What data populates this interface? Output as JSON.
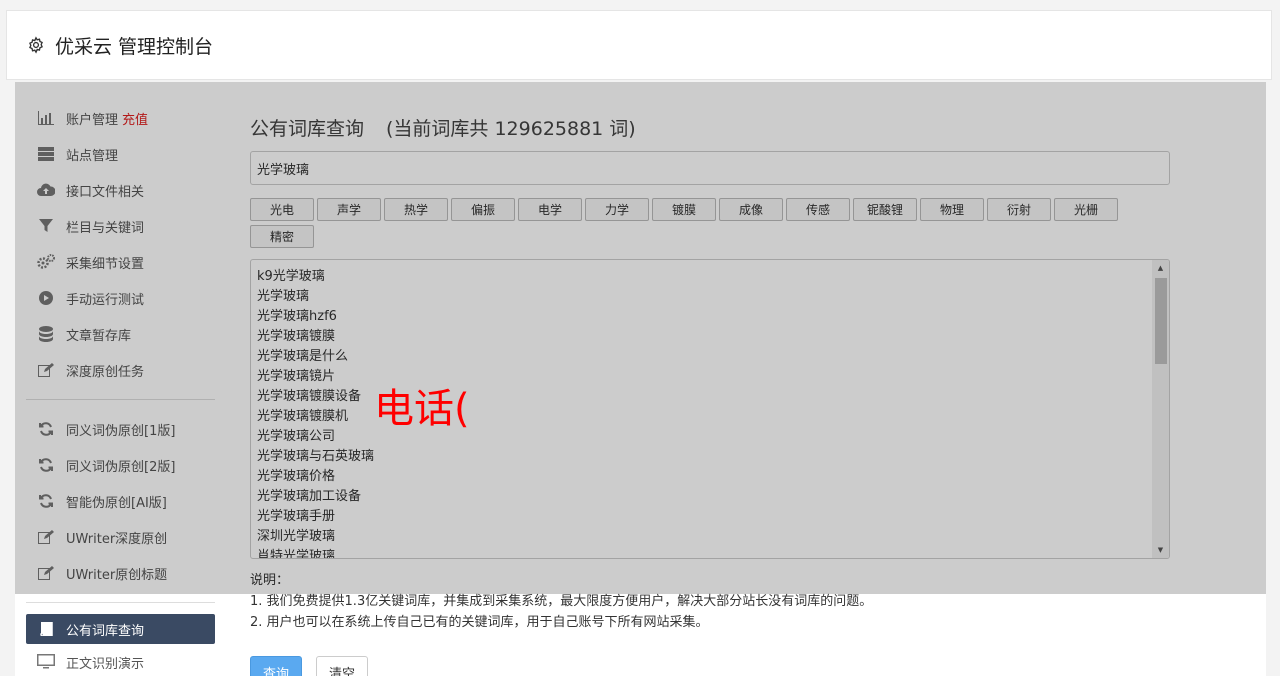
{
  "header": {
    "title": "优采云 管理控制台"
  },
  "sidebar": {
    "group1": [
      {
        "label": "账户管理",
        "extra": "充值",
        "icon": "bar-chart-icon"
      },
      {
        "label": "站点管理",
        "icon": "server-icon"
      },
      {
        "label": "接口文件相关",
        "icon": "cloud-upload-icon"
      },
      {
        "label": "栏目与关键词",
        "icon": "filter-icon"
      },
      {
        "label": "采集细节设置",
        "icon": "gears-icon"
      },
      {
        "label": "手动运行测试",
        "icon": "play-circle-icon"
      },
      {
        "label": "文章暂存库",
        "icon": "database-icon"
      },
      {
        "label": "深度原创任务",
        "icon": "edit-icon"
      }
    ],
    "group2": [
      {
        "label": "同义词伪原创[1版]",
        "icon": "refresh-icon"
      },
      {
        "label": "同义词伪原创[2版]",
        "icon": "refresh-icon"
      },
      {
        "label": "智能伪原创[AI版]",
        "icon": "refresh-icon"
      },
      {
        "label": "UWriter深度原创",
        "icon": "edit-icon"
      },
      {
        "label": "UWriter原创标题",
        "icon": "edit-icon"
      }
    ],
    "group3": [
      {
        "label": "公有词库查询",
        "icon": "book-icon",
        "active": true
      },
      {
        "label": "正文识别演示",
        "icon": "monitor-icon"
      }
    ]
  },
  "main": {
    "title": "公有词库查询",
    "count_text": "(当前词库共 129625881 词)",
    "search_value": "光学玻璃",
    "tags": [
      "光电",
      "声学",
      "热学",
      "偏振",
      "电学",
      "力学",
      "镀膜",
      "成像",
      "传感",
      "铌酸锂",
      "物理",
      "衍射",
      "光栅",
      "精密"
    ],
    "words": [
      "k9光学玻璃",
      "光学玻璃",
      "光学玻璃hzf6",
      "光学玻璃镀膜",
      "光学玻璃是什么",
      "光学玻璃镜片",
      "光学玻璃镀膜设备",
      "光学玻璃镀膜机",
      "光学玻璃公司",
      "光学玻璃与石英玻璃",
      "光学玻璃价格",
      "光学玻璃加工设备",
      "光学玻璃手册",
      "深圳光学玻璃",
      "肖特光学玻璃"
    ],
    "overlay": "电话(",
    "notes": {
      "heading": "说明：",
      "line1": "1. 我们免费提供1.3亿关键词库，并集成到采集系统，最大限度方便用户，解决大部分站长没有词库的问题。",
      "line2": "2. 用户也可以在系统上传自己已有的关键词库，用于自己账号下所有网站采集。"
    },
    "buttons": {
      "query": "查询",
      "clear": "清空"
    }
  },
  "colors": {
    "active_nav": "#3a4a63",
    "recharge": "#e02020",
    "primary": "#5aa9f0",
    "overlay": "#ff0000"
  }
}
